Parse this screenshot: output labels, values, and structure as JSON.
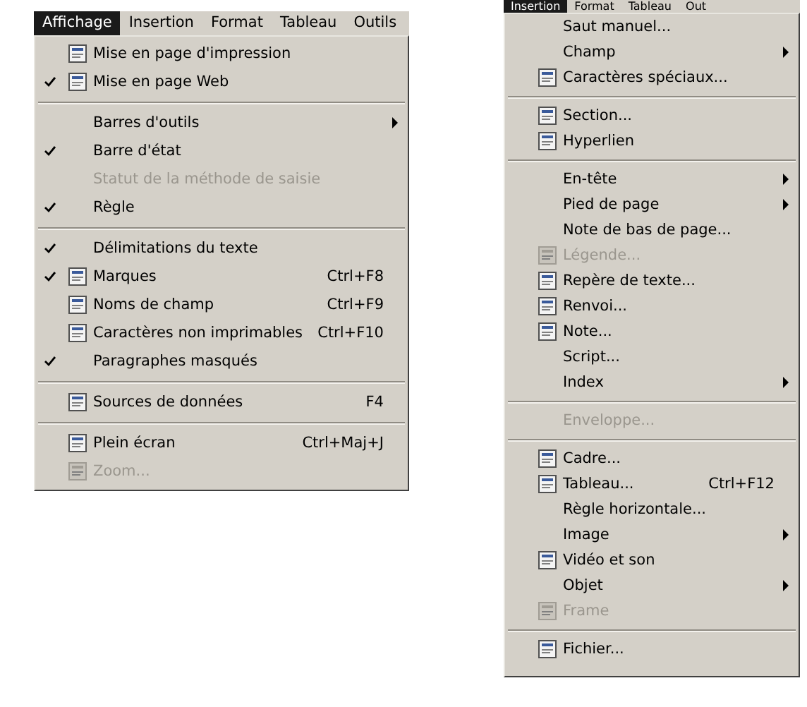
{
  "menus": [
    {
      "menubar": [
        {
          "label": "Affichage",
          "selected": true
        },
        {
          "label": "Insertion",
          "selected": false
        },
        {
          "label": "Format",
          "selected": false
        },
        {
          "label": "Tableau",
          "selected": false
        },
        {
          "label": "Outils",
          "selected": false
        }
      ],
      "items": [
        {
          "kind": "item",
          "label": "Mise en page d'impression",
          "icon": true,
          "checked": false,
          "disabled": false
        },
        {
          "kind": "item",
          "label": "Mise en page Web",
          "icon": true,
          "checked": true,
          "disabled": false
        },
        {
          "kind": "separator"
        },
        {
          "kind": "item",
          "label": "Barres d'outils",
          "checked": false,
          "disabled": false,
          "submenu": true
        },
        {
          "kind": "item",
          "label": "Barre d'état",
          "checked": true,
          "disabled": false
        },
        {
          "kind": "item",
          "label": "Statut de la méthode de saisie",
          "checked": false,
          "disabled": true
        },
        {
          "kind": "item",
          "label": "Règle",
          "checked": true,
          "disabled": false
        },
        {
          "kind": "separator"
        },
        {
          "kind": "item",
          "label": "Délimitations du texte",
          "checked": true,
          "disabled": false
        },
        {
          "kind": "item",
          "label": "Marques",
          "icon": true,
          "checked": true,
          "disabled": false,
          "shortcut": "Ctrl+F8"
        },
        {
          "kind": "item",
          "label": "Noms de champ",
          "icon": true,
          "checked": false,
          "disabled": false,
          "shortcut": "Ctrl+F9"
        },
        {
          "kind": "item",
          "label": "Caractères non imprimables",
          "icon": true,
          "checked": false,
          "disabled": false,
          "shortcut": "Ctrl+F10"
        },
        {
          "kind": "item",
          "label": "Paragraphes masqués",
          "checked": true,
          "disabled": false
        },
        {
          "kind": "separator"
        },
        {
          "kind": "item",
          "label": "Sources de données",
          "icon": true,
          "checked": false,
          "disabled": false,
          "shortcut": "F4"
        },
        {
          "kind": "separator"
        },
        {
          "kind": "item",
          "label": "Plein écran",
          "icon": true,
          "checked": false,
          "disabled": false,
          "shortcut": "Ctrl+Maj+J"
        },
        {
          "kind": "item",
          "label": "Zoom...",
          "icon": true,
          "checked": false,
          "disabled": true
        }
      ]
    },
    {
      "menubar": [
        {
          "label": "Insertion",
          "selected": true
        },
        {
          "label": "Format",
          "selected": false
        },
        {
          "label": "Tableau",
          "selected": false
        },
        {
          "label": "Out",
          "selected": false
        }
      ],
      "items": [
        {
          "kind": "item",
          "label": "Saut manuel...",
          "disabled": false
        },
        {
          "kind": "item",
          "label": "Champ",
          "disabled": false,
          "submenu": true
        },
        {
          "kind": "item",
          "label": "Caractères spéciaux...",
          "icon": true,
          "disabled": false
        },
        {
          "kind": "separator"
        },
        {
          "kind": "item",
          "label": "Section...",
          "icon": true,
          "disabled": false
        },
        {
          "kind": "item",
          "label": "Hyperlien",
          "icon": true,
          "disabled": false
        },
        {
          "kind": "separator"
        },
        {
          "kind": "item",
          "label": "En-tête",
          "disabled": false,
          "submenu": true
        },
        {
          "kind": "item",
          "label": "Pied de page",
          "disabled": false,
          "submenu": true
        },
        {
          "kind": "item",
          "label": "Note de bas de page...",
          "disabled": false
        },
        {
          "kind": "item",
          "label": "Légende...",
          "icon": true,
          "disabled": true
        },
        {
          "kind": "item",
          "label": "Repère de texte...",
          "icon": true,
          "disabled": false
        },
        {
          "kind": "item",
          "label": "Renvoi...",
          "icon": true,
          "disabled": false
        },
        {
          "kind": "item",
          "label": "Note...",
          "icon": true,
          "disabled": false
        },
        {
          "kind": "item",
          "label": "Script...",
          "disabled": false
        },
        {
          "kind": "item",
          "label": "Index",
          "disabled": false,
          "submenu": true
        },
        {
          "kind": "separator"
        },
        {
          "kind": "item",
          "label": "Enveloppe...",
          "disabled": true
        },
        {
          "kind": "separator"
        },
        {
          "kind": "item",
          "label": "Cadre...",
          "icon": true,
          "disabled": false
        },
        {
          "kind": "item",
          "label": "Tableau...",
          "icon": true,
          "disabled": false,
          "shortcut": "Ctrl+F12"
        },
        {
          "kind": "item",
          "label": "Règle horizontale...",
          "disabled": false
        },
        {
          "kind": "item",
          "label": "Image",
          "disabled": false,
          "submenu": true
        },
        {
          "kind": "item",
          "label": "Vidéo et son",
          "icon": true,
          "disabled": false
        },
        {
          "kind": "item",
          "label": "Objet",
          "disabled": false,
          "submenu": true
        },
        {
          "kind": "item",
          "label": "Frame",
          "icon": true,
          "disabled": true
        },
        {
          "kind": "separator"
        },
        {
          "kind": "item",
          "label": "Fichier...",
          "icon": true,
          "disabled": false
        }
      ]
    }
  ]
}
